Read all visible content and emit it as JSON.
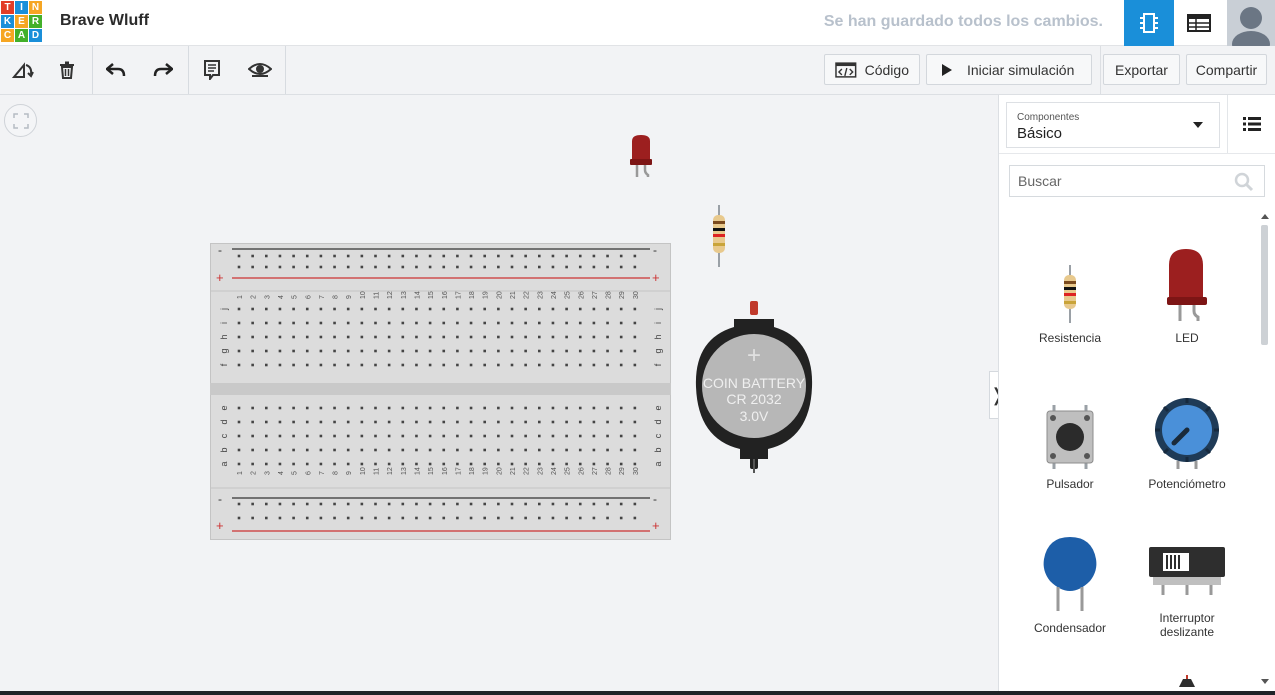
{
  "logo": {
    "letters": [
      "T",
      "I",
      "N",
      "K",
      "E",
      "R",
      "C",
      "A",
      "D"
    ],
    "colors": [
      "#e23d28",
      "#1a8fd9",
      "#f6a623",
      "#1a8fd9",
      "#f6a623",
      "#43b02a",
      "#f6a623",
      "#43b02a",
      "#1a8fd9"
    ]
  },
  "header": {
    "project_name": "Brave Wluff",
    "save_status": "Se han guardado todos los cambios.",
    "accent": "#1a8fd9"
  },
  "toolbar": {
    "tools": [
      {
        "name": "rotate",
        "icon": "rotate-icon"
      },
      {
        "name": "delete",
        "icon": "trash-icon"
      },
      {
        "name": "undo",
        "icon": "undo-icon"
      },
      {
        "name": "redo",
        "icon": "redo-icon"
      },
      {
        "name": "notes",
        "icon": "notes-icon"
      },
      {
        "name": "visibility",
        "icon": "eye-icon"
      }
    ],
    "code_label": "Código",
    "simulate_label": "Iniciar simulación",
    "export_label": "Exportar",
    "share_label": "Compartir"
  },
  "canvas": {
    "battery": {
      "line1": "COIN BATTERY",
      "line2": "CR 2032",
      "line3": "3.0V",
      "plus": "+"
    },
    "breadboard": {
      "minus": "-",
      "plus": "+",
      "rows_top": [
        "j",
        "i",
        "h",
        "g",
        "f"
      ],
      "rows_bottom": [
        "e",
        "d",
        "c",
        "b",
        "a"
      ],
      "columns": 30
    }
  },
  "panel": {
    "components_label": "Componentes",
    "components_value": "Básico",
    "search_placeholder": "Buscar",
    "items": [
      {
        "label": "Resistencia"
      },
      {
        "label": "LED"
      },
      {
        "label": "Pulsador"
      },
      {
        "label": "Potenciómetro"
      },
      {
        "label": "Condensador"
      },
      {
        "label": "Interruptor deslizante"
      }
    ]
  }
}
